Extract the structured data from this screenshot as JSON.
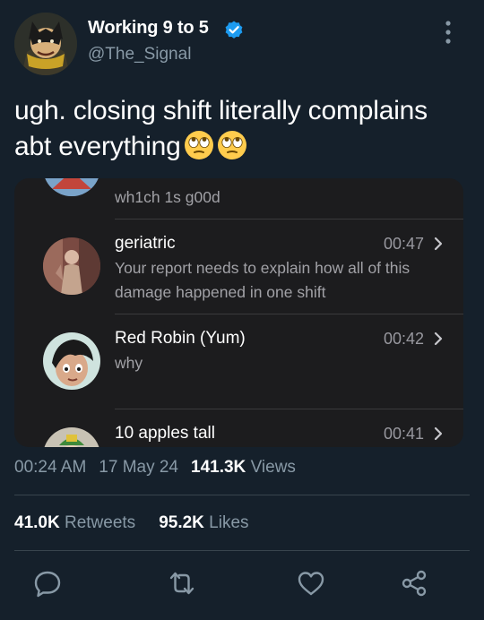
{
  "author": {
    "display_name": "Working 9 to 5",
    "handle": "@The_Signal",
    "verified_icon": "verified-badge-icon"
  },
  "tweet": {
    "text": "ugh. closing shift literally complains abt everything",
    "emoji": [
      "face-with-rolling-eyes",
      "face-with-rolling-eyes"
    ]
  },
  "embedded_screenshot": {
    "clipped_top_row": {
      "message": "wh1ch 1s g00d"
    },
    "conversations": [
      {
        "name": "geriatric",
        "time": "00:47",
        "message": "Your report needs to explain how all of this damage happened in one shift"
      },
      {
        "name": "Red Robin (Yum)",
        "time": "00:42",
        "message": "why"
      },
      {
        "name": "10 apples tall",
        "time": "00:41",
        "message": ""
      }
    ]
  },
  "meta": {
    "time": "00:24 AM",
    "date": "17 May 24",
    "views_count": "141.3K",
    "views_label": "Views"
  },
  "stats": {
    "retweets_count": "41.0K",
    "retweets_label": "Retweets",
    "likes_count": "95.2K",
    "likes_label": "Likes"
  },
  "actions": [
    "reply-icon",
    "retweet-icon",
    "like-icon",
    "share-icon"
  ],
  "colors": {
    "background": "#15202b",
    "secondary_text": "#8899a6",
    "verified_blue": "#1d9bf0",
    "embed_background": "#1c1c1e"
  }
}
